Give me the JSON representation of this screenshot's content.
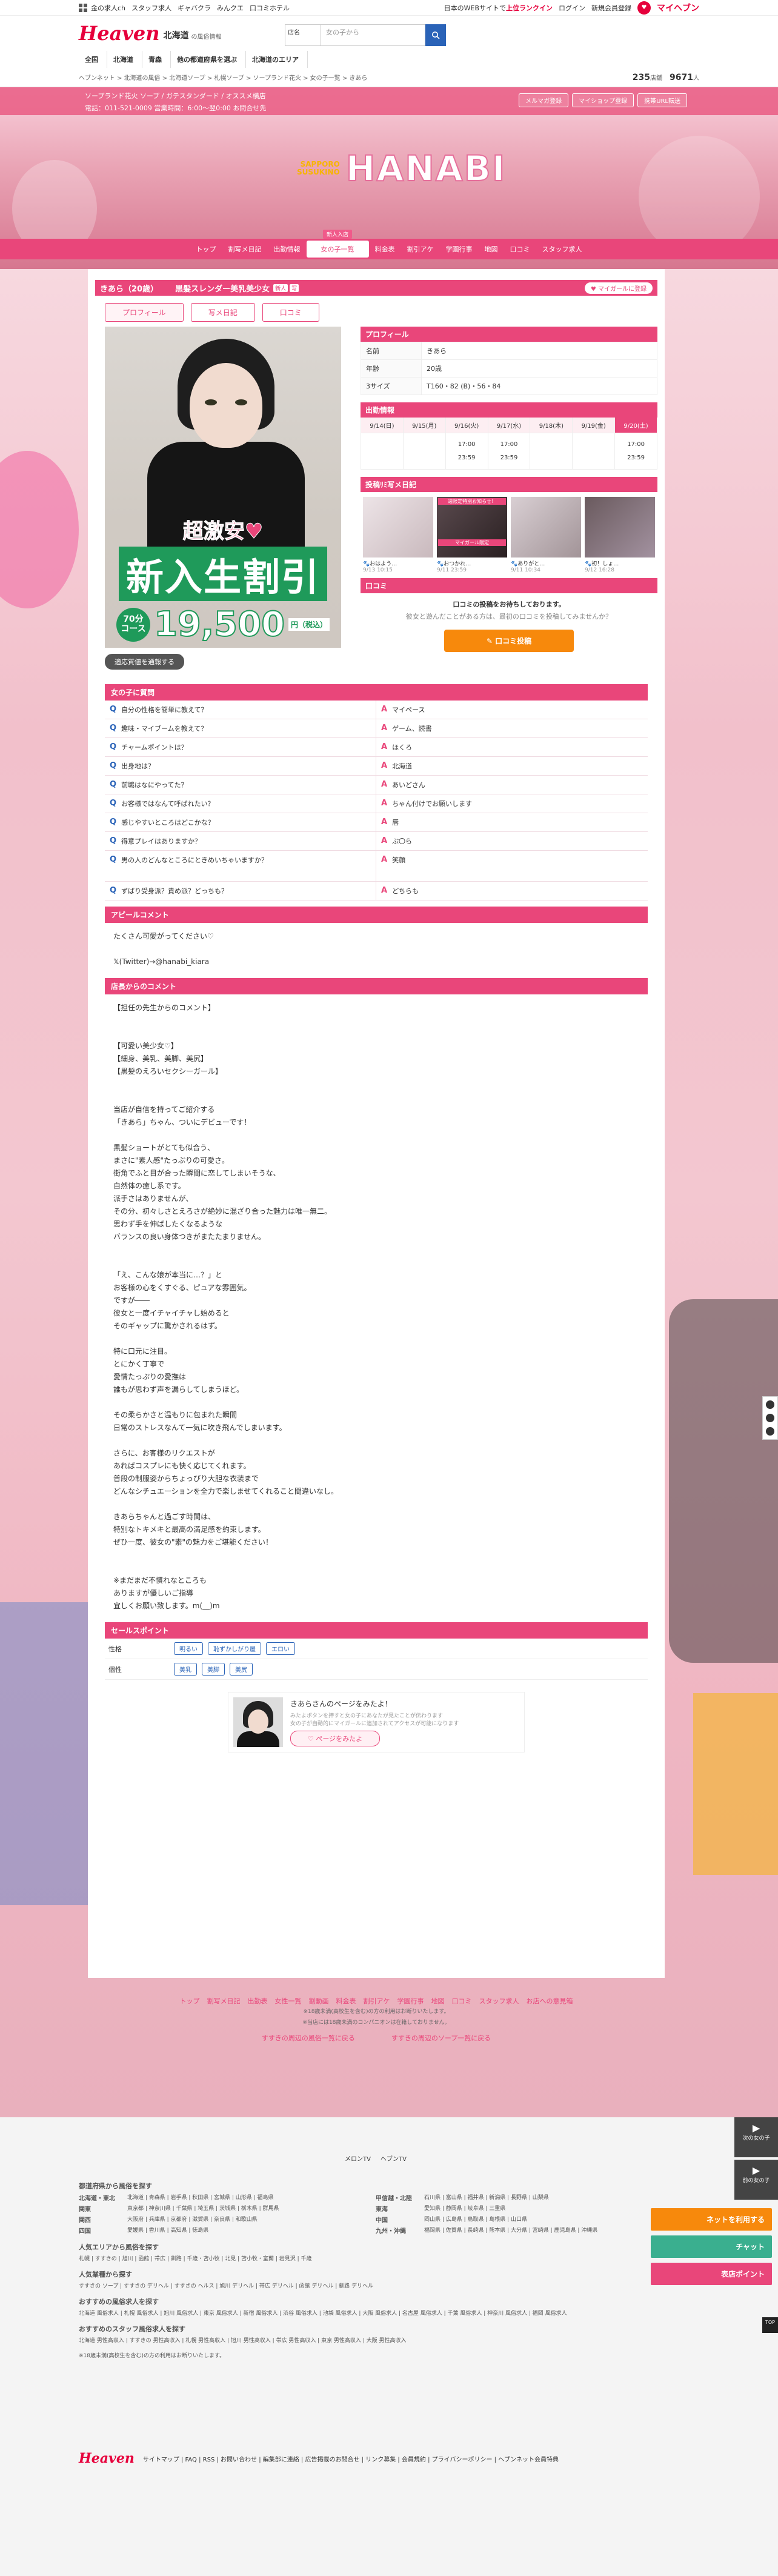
{
  "util": {
    "links": [
      "金の求人ch",
      "スタッフ求人",
      "ギャバクラ",
      "みんクエ",
      "口コミホテル"
    ],
    "right_text": "日本のWEBサイトで",
    "right_bold": "上位ランクイン",
    "login": "ログイン",
    "register": "新規会員登録",
    "myheaven": "マイヘブン"
  },
  "header": {
    "logo": "Heaven",
    "region": "北海道",
    "region_sub": "の風俗情報",
    "search_cat": "店名",
    "search_placeholder": "女の子から",
    "nav": [
      "全国",
      "北海道",
      "青森",
      "他の都道府県を選ぶ",
      "北海道のエリア"
    ]
  },
  "breadcrumb": "ヘブンネット > 北海道の風俗 > 北海道ソープ > 札幌ソープ > ソープランド花火 > 女の子一覧 > きあら",
  "counts": {
    "shops": "235",
    "shops_unit": "店舗",
    "girls": "9671",
    "girls_unit": "人"
  },
  "shop": {
    "line1": "ソープランド花火 ソープ / ガテスタンダード / オススメ横店",
    "line2": "電話：011-521-0009 営業時間：6:00〜翌0:00 お問合せ先",
    "buttons": [
      "メルマガ登録",
      "マイショップ登録",
      "携帯URL転送"
    ],
    "brand_left1": "SAPPORO",
    "brand_left2": "SUSUKINO",
    "brand": "HANABI",
    "nav": [
      "トップ",
      "割写メ日記",
      "出勤情報",
      "女の子一覧",
      "料金表",
      "割引アケ",
      "学園行事",
      "地図",
      "口コミ",
      "スタッフ求人"
    ],
    "nav_active": "女の子一覧",
    "nav_tag": "新人入店"
  },
  "girl": {
    "name": "きあら（20歳）",
    "catch": "黒髪スレンダー美乳美少女",
    "badges": [
      "新人",
      "写"
    ],
    "fav": "マイガールに登録",
    "tabs": [
      "プロフィール",
      "写メ日記",
      "口コミ"
    ],
    "photo_promo1": "超激安♥",
    "photo_promo2": "新入生割引",
    "photo_min_a": "70分",
    "photo_min_b": "コース",
    "photo_price": "19,500",
    "photo_tax": "円（税込）",
    "photo_button": "適応質値を通報する"
  },
  "profile": {
    "title": "プロフィール",
    "rows": [
      {
        "k": "名前",
        "v": "きあら"
      },
      {
        "k": "年齢",
        "v": "20歳"
      },
      {
        "k": "3サイズ",
        "v": "T160・82 (B)・56・84"
      }
    ]
  },
  "schedule": {
    "title": "出勤情報",
    "days": [
      "9/14(日)",
      "9/15(月)",
      "9/16(火)",
      "9/17(水)",
      "9/18(木)",
      "9/19(金)",
      "9/20(土)"
    ],
    "times": [
      [
        "",
        ""
      ],
      [
        "",
        ""
      ],
      [
        "17:00",
        "23:59"
      ],
      [
        "17:00",
        "23:59"
      ],
      [
        "",
        ""
      ],
      [
        "",
        ""
      ],
      [
        "17:00",
        "23:59"
      ]
    ]
  },
  "diary": {
    "title": "投稿ﾘﾐ写メ日記",
    "items": [
      {
        "label": "",
        "cap": "🐾おはよう…",
        "date": "9/13 10:15"
      },
      {
        "label": "週限定特別お知らせ！",
        "cap": "🐾おつかれ…",
        "date": "9/11 23:59"
      },
      {
        "label": "",
        "cap": "🐾ありがと…",
        "date": "9/11 10:34"
      },
      {
        "label": "",
        "cap": "🐾初！しょ…",
        "date": "9/12 16:28"
      }
    ],
    "badge": "マイガール限定"
  },
  "review": {
    "title": "口コミ",
    "t1": "口コミの投稿をお待ちしております。",
    "t2": "彼女と遊んだことがある方は、最初の口コミを投稿してみませんか？",
    "button": "✎ 口コミ投稿"
  },
  "qa": {
    "title": "女の子に質問",
    "items": [
      {
        "q": "自分の性格を簡単に教えて？",
        "a": "マイペース"
      },
      {
        "q": "趣味・マイブームを教えて？",
        "a": "ゲーム、読書"
      },
      {
        "q": "チャームポイントは？",
        "a": "ほくろ"
      },
      {
        "q": "出身地は？",
        "a": "北海道"
      },
      {
        "q": "前職はなにやってた？",
        "a": "あいどさん"
      },
      {
        "q": "お客様ではなんて呼ばれたい？",
        "a": "ちゃん付けでお願いします"
      },
      {
        "q": "感じやすいところはどこかな？",
        "a": "唇"
      },
      {
        "q": "得意プレイはありますか？",
        "a": "ぶ〇ら"
      },
      {
        "q": "男の人のどんなところにときめいちゃいますか？",
        "a": "笑顔"
      },
      {
        "q": "ずばり受身派？責め派？どっちも？",
        "a": "どちらも"
      }
    ]
  },
  "appeal": {
    "title": "アピールコメント",
    "text": "たくさん可愛がってください♡\n\n𝕏(Twitter)→@hanabi_kiara"
  },
  "shop_comment": {
    "title": "店長からのコメント",
    "text": "【担任の先生からのコメント】\n\n\n【可愛い美少女♡】\n【細身、美乳、美脚、美尻】\n【黒髪のえろいセクシーガール】\n\n\n当店が自信を持ってご紹介する\n「きあら」ちゃん、ついにデビューです！\n\n黒髪ショートがとても似合う、\nまさに\"素人感\"たっぷりの可愛さ。\n街角でふと目が合った瞬間に恋してしまいそうな、\n自然体の癒し系です。\n派手さはありませんが、\nその分、初々しさとえろさが絶妙に混ざり合った魅力は唯一無二。\n思わず手を伸ばしたくなるような\nバランスの良い身体つきがまたたまりません。\n\n\n「え、こんな娘が本当に…？」と\nお客様の心をくすぐる、ピュアな雰囲気。\nですが――\n彼女と一度イチャイチャし始めると\nそのギャップに驚かされるはず。\n\n特に口元に注目。\nとにかく丁寧で\n愛情たっぷりの愛撫は\n誰もが思わず声を漏らしてしまうほど。\n\nその柔らかさと温もりに包まれた瞬間\n日常のストレスなんて一気に吹き飛んでしまいます。\n\nさらに、お客様のリクエストが\nあればコスプレにも快く応じてくれます。\n普段の制服姿からちょっぴり大胆な衣装まで\nどんなシチュエーションを全力で楽しませてくれること間違いなし。\n\nきあらちゃんと過ごす時間は、\n特別なトキメキと最高の満足感を約束します。\nぜひ一度、彼女の\"素\"の魅力をご堪能ください！\n\n\n※まだまだ不慣れなところも\nありますが優しいご指導\n宜しくお願い致します。m(__)m"
  },
  "selling": {
    "title": "セールスポイント",
    "rows": [
      {
        "k": "性格",
        "chips": [
          "明るい",
          "恥ずかしがり屋",
          "エロい"
        ]
      },
      {
        "k": "個性",
        "chips": [
          "美乳",
          "美脚",
          "美尻"
        ]
      }
    ]
  },
  "share": {
    "t1": "きあらさんのページをみたよ！",
    "t2": "みたよボタンを押すと女の子にあなたが見たことが伝わります\n女の子が自動的にマイガールに追加されてアクセスが可能になります",
    "button": "♡ ページをみたよ"
  },
  "foot": {
    "links": [
      "トップ",
      "割写メ日記",
      "出勤表",
      "女性一覧",
      "割動画",
      "料金表",
      "割引アケ",
      "学園行事",
      "地図",
      "口コミ",
      "スタッフ求人",
      "お店への意見箱"
    ],
    "note1": "※18歳未満(高校生を含む)の方の利用はお断りいたします。",
    "note2": "※当店には18歳未満のコンパニオンは在籍しておりません。",
    "more1": "すすきの周辺の風俗一覧に戻る",
    "more2": "すすきの周辺のソープ一覧に戻る"
  },
  "pager": [
    "次の女の子",
    "前の女の子"
  ],
  "float_btns": [
    "ネットを利用する",
    "チャット",
    "表店ポイント"
  ],
  "totop": "TOP",
  "fnav": {
    "media": [
      "メロンTV",
      "ヘブンTV"
    ],
    "h1": "都道府県から風俗を探す",
    "regions": [
      {
        "k": "北海道・東北",
        "v": "北海道 | 青森県 | 岩手県 | 秋田県 | 宮城県 | 山形県 | 福島県",
        "k2": "甲信越・北陸",
        "v2": "石川県 | 富山県 | 福井県 | 新潟県 | 長野県 | 山梨県"
      },
      {
        "k": "関東",
        "v": "東京都 | 神奈川県 | 千葉県 | 埼玉県 | 茨城県 | 栃木県 | 群馬県",
        "k2": "東海",
        "v2": "愛知県 | 静岡県 | 岐阜県 | 三重県"
      },
      {
        "k": "関西",
        "v": "大阪府 | 兵庫県 | 京都府 | 滋賀県 | 奈良県 | 和歌山県",
        "k2": "中国",
        "v2": "岡山県 | 広島県 | 鳥取県 | 島根県 | 山口県"
      },
      {
        "k": "四国",
        "v": "愛媛県 | 香川県 | 高知県 | 徳島県",
        "k2": "九州・沖縄",
        "v2": "福岡県 | 佐賀県 | 長崎県 | 熊本県 | 大分県 | 宮崎県 | 鹿児島県 | 沖縄県"
      }
    ],
    "h2": "人気エリアから風俗を探す",
    "l2": "札幌 | すすきの | 旭川 | 函館 | 帯広 | 釧路 | 千歳・苫小牧 | 北見 | 苫小牧・室蘭 | 岩見沢 | 千歳",
    "h3": "人気業種から探す",
    "l3": "すすきの ソープ | すすきの デリヘル | すすきの ヘルス | 旭川 デリヘル | 帯広 デリヘル | 函館 デリヘル | 釧路 デリヘル",
    "h4": "おすすめの風俗求人を探す",
    "l4": "北海道 風俗求人 | 札幌 風俗求人 | 旭川 風俗求人 | 東京 風俗求人 | 新宿 風俗求人 | 渋谷 風俗求人 | 池袋 風俗求人 | 大阪 風俗求人 | 名古屋 風俗求人 | 千葉 風俗求人 | 神奈川 風俗求人 | 福岡 風俗求人",
    "h5": "おすすめのスタッフ風俗求人を探す",
    "l5": "北海道 男性高収入 | すすきの 男性高収入 | 札幌 男性高収入 | 旭川 男性高収入 | 帯広 男性高収入 | 東京 男性高収入 | 大阪 男性高収入",
    "copy": "※18歳未満(高校生を含む)の方の利用はお断りいたします。"
  },
  "footer": {
    "logo": "Heaven",
    "links": "サイトマップ | FAQ | RSS | お問い合わせ | 編集部に連絡 | 広告掲載のお問合せ | リンク募集 | 会員規約 | プライバシーポリシー | ヘブンネット会員特典"
  }
}
